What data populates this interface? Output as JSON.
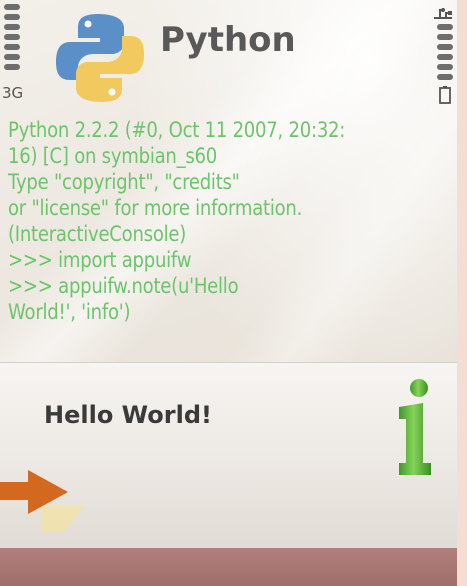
{
  "status_bar": {
    "network": "3G",
    "signal_icon": "signal-strength-icon",
    "battery_icon": "battery-icon",
    "usb_icon": "usb-connection-icon"
  },
  "title_bar": {
    "app_title": "Python",
    "logo_icon": "python-logo-icon"
  },
  "console": {
    "lines": [
      "Python 2.2.2 (#0, Oct 11 2007, 20:32:",
      "16) [C] on symbian_s60",
      "Type \"copyright\", \"credits\"",
      "or \"license\" for more information.",
      "(InteractiveConsole)",
      ">>> import appuifw",
      ">>> appuifw.note(u'Hello",
      "World!', 'info')"
    ],
    "text_color": "#6cc56a"
  },
  "note": {
    "text": "Hello World!",
    "type_icon": "info-icon",
    "icon_color": "#5db83a"
  },
  "overlay": {
    "arrow_icon": "orange-arrow-icon",
    "arrow_color": "#d2691e"
  },
  "colors": {
    "softkey_bar": "#a87573",
    "side_strip": "#f6ddd4"
  }
}
